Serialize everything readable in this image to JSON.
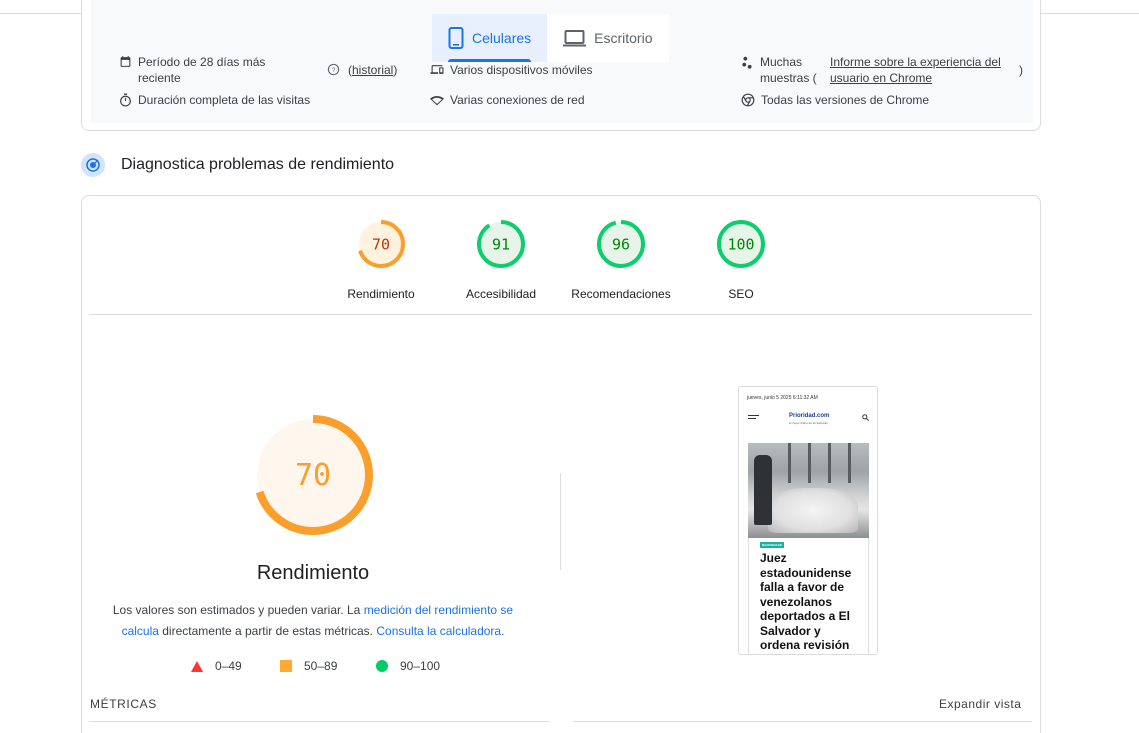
{
  "device_tabs": {
    "mobile": "Celulares",
    "desktop": "Escritorio"
  },
  "field_info": {
    "period": "Período de 28 días más reciente",
    "period_line1": "Período de 28 días más",
    "period_line2": "reciente",
    "history_link": "historial",
    "history_open": "(",
    "history_close": ")",
    "devices": "Varios dispositivos móviles",
    "samples_line1": "Muchas",
    "samples_line2": "muestras (",
    "report_link_line1": "Informe sobre la experiencia del",
    "report_link_line2": "usuario en Chrome",
    "report_close": ")",
    "duration": "Duración completa de las visitas",
    "network": "Varias conexiones de red",
    "chrome_versions": "Todas las versiones de Chrome"
  },
  "diagnostics": {
    "title": "Diagnostica problemas de rendimiento"
  },
  "scores": [
    {
      "label": "Rendimiento",
      "value": 70,
      "color": "#fa9f2c",
      "text_color": "#c33300",
      "fill": "#fff3e0"
    },
    {
      "label": "Accesibilidad",
      "value": 91,
      "color": "#0cce6b",
      "text_color": "#008800",
      "fill": "#e6f4ea"
    },
    {
      "label": "Recomendaciones",
      "value": 96,
      "color": "#0cce6b",
      "text_color": "#008800",
      "fill": "#e6f4ea"
    },
    {
      "label": "SEO",
      "value": 100,
      "color": "#0cce6b",
      "text_color": "#008800",
      "fill": "#e6f4ea"
    }
  ],
  "performance": {
    "value": 70,
    "label": "Rendimiento",
    "desc_1": "Los valores son estimados y pueden variar. La ",
    "desc_link1": "medición del rendimiento se calcula",
    "desc_2": " directamente a partir de estas métricas. ",
    "desc_link2": "Consulta la calculadora.",
    "color": "#fa9f2c",
    "text_color": "#fa9f2c",
    "fill": "#fff7ee"
  },
  "legend": {
    "fail": "0–49",
    "average": "50–89",
    "pass": "90–100",
    "fail_color": "#ff3333",
    "average_color": "#ffaa33",
    "pass_color": "#00cc66"
  },
  "screenshot": {
    "date": "jueves, junio 5 2025     6:11:32 AM",
    "logo": "Prioridad.com",
    "logo_sub": "el mejor diario de El Salvador",
    "badge": "NACIONALES",
    "headline": "Juez estadounidense falla a favor de venezolanos deportados a El Salvador y ordena revisión"
  },
  "metrics": {
    "label": "MÉTRICAS",
    "expand": "Expandir vista"
  }
}
